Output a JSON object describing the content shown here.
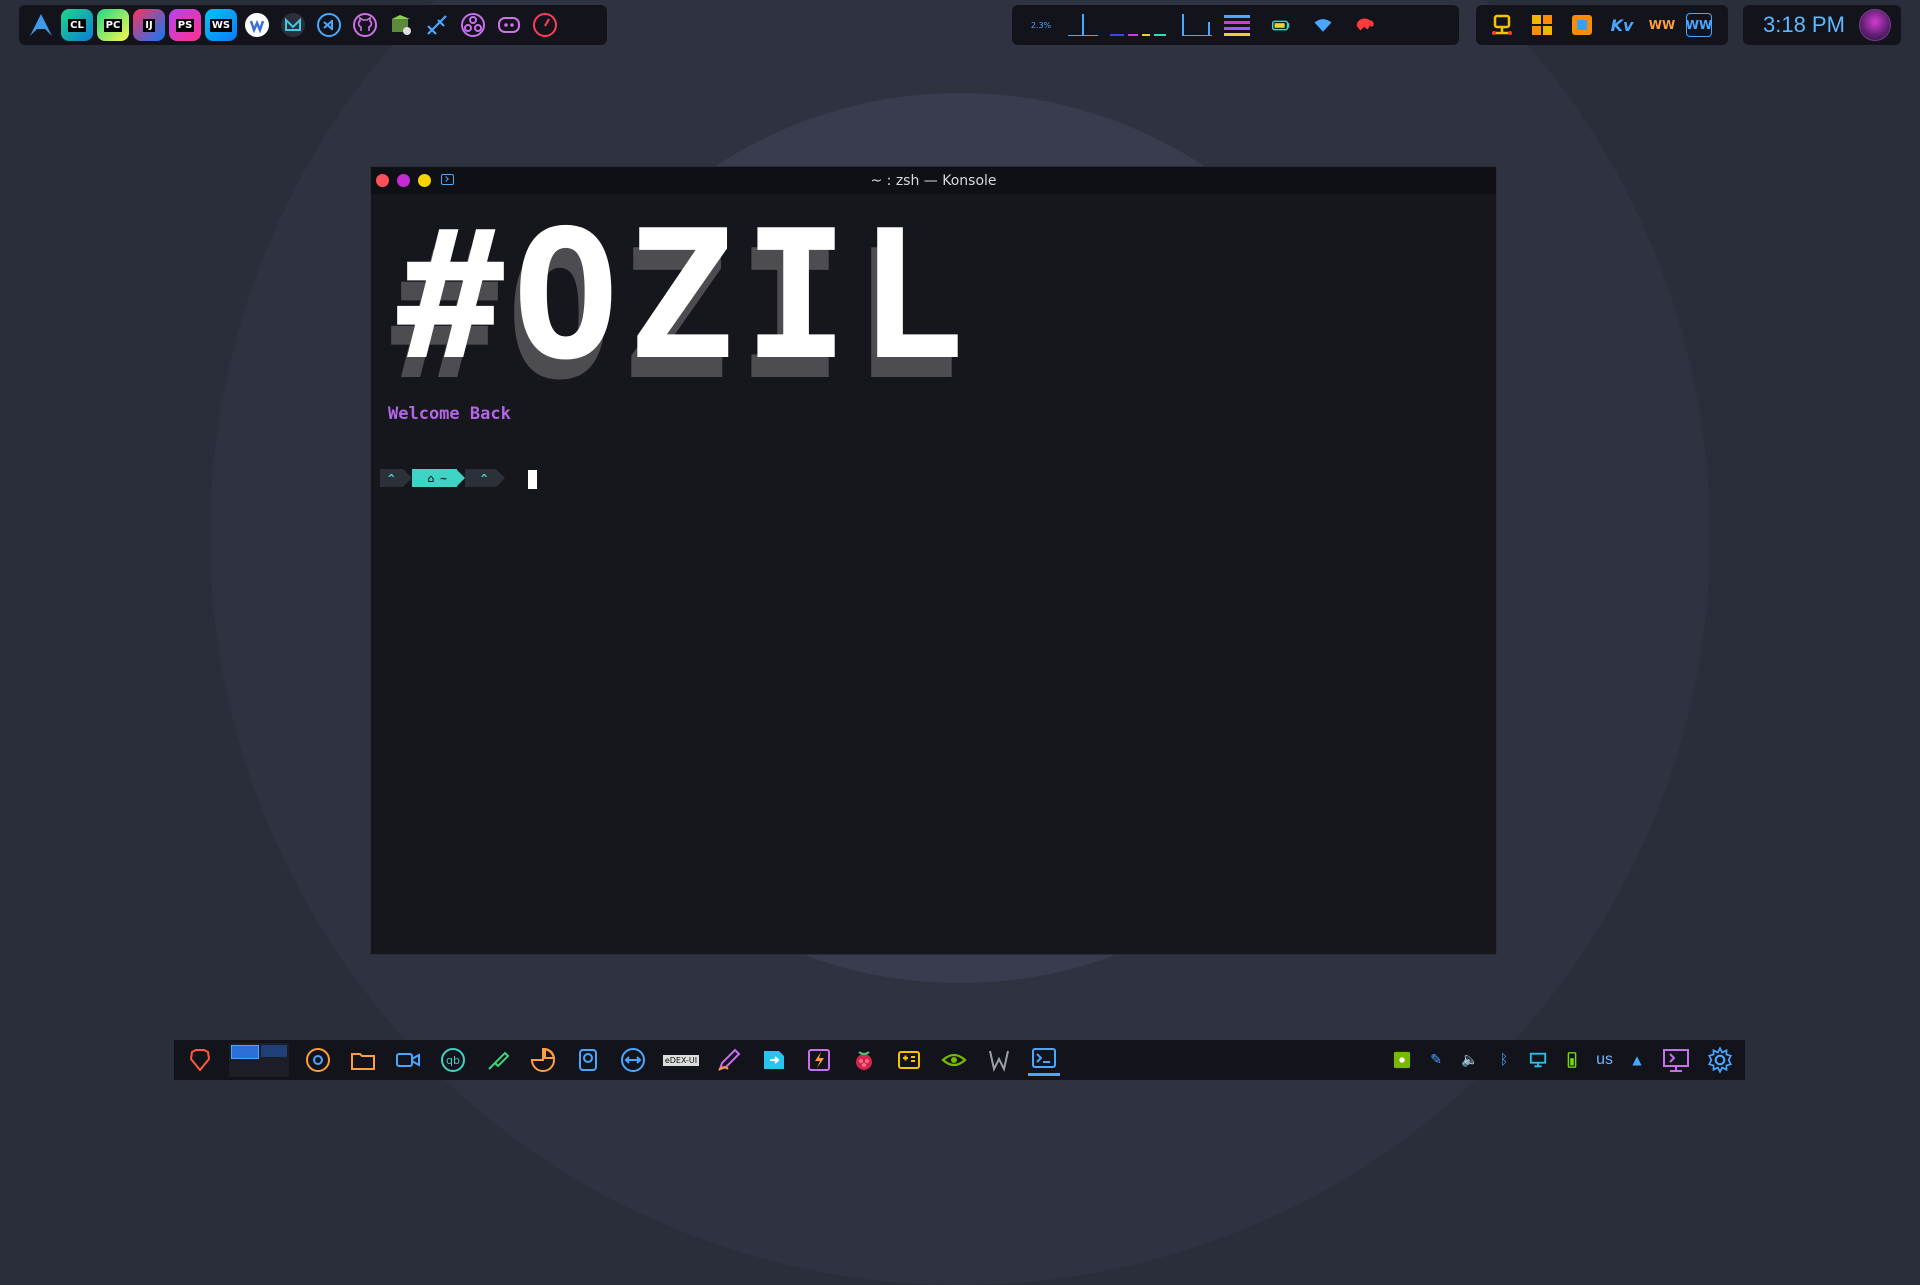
{
  "window": {
    "title": "~ : zsh — Konsole",
    "banner": "#OZIL",
    "welcome": "Welcome Back",
    "prompt_segments": [
      "^",
      "~",
      "^"
    ]
  },
  "top_panel": {
    "launchers": [
      {
        "name": "arch-menu-icon",
        "label": ""
      },
      {
        "name": "clion-icon",
        "label": "CL"
      },
      {
        "name": "pycharm-icon",
        "label": "PC"
      },
      {
        "name": "intellij-icon",
        "label": "IJ"
      },
      {
        "name": "phpstorm-icon",
        "label": "PS"
      },
      {
        "name": "webstorm-icon",
        "label": "WS"
      },
      {
        "name": "webapp-icon",
        "label": ""
      },
      {
        "name": "mailspring-icon",
        "label": ""
      },
      {
        "name": "vscode-icon",
        "label": ""
      },
      {
        "name": "github-icon",
        "label": ""
      },
      {
        "name": "archive-icon",
        "label": ""
      },
      {
        "name": "rocket-icon",
        "label": ""
      },
      {
        "name": "obs-icon",
        "label": ""
      },
      {
        "name": "discord-icon",
        "label": ""
      },
      {
        "name": "speedometer-icon",
        "label": ""
      }
    ],
    "cpu_label": "2.3%",
    "apps": [
      {
        "name": "network-app-icon",
        "label": ""
      },
      {
        "name": "layout-app-icon",
        "label": ""
      },
      {
        "name": "window-app-icon",
        "label": ""
      },
      {
        "name": "kv-app-icon",
        "label": "Kv"
      },
      {
        "name": "wave-app-icon",
        "label": "WW"
      },
      {
        "name": "wave2-app-icon",
        "label": "WW"
      }
    ],
    "clock": "3:18 PM"
  },
  "taskbar": {
    "apps": [
      "brave-icon",
      "chrome-icon",
      "files-icon",
      "video-call-icon",
      "qbittorrent-icon",
      "usb-icon",
      "disk-usage-icon",
      "backup-icon",
      "teamviewer-icon",
      "edex-ui-icon",
      "draw-icon",
      "remote-desktop-icon",
      "lightning-icon",
      "raspberry-pi-icon",
      "games-icon",
      "nvidia-icon",
      "predator-icon",
      "terminal-icon"
    ],
    "edex_label": "eDEX-UI",
    "keyboard_layout": "us"
  },
  "colors": {
    "accent_blue": "#4aa7ff",
    "accent_teal": "#3fd3c6",
    "accent_purple": "#b266e6",
    "close": "#ff4f5a",
    "minimize": "#c42bd3",
    "maximize": "#f5d200"
  }
}
